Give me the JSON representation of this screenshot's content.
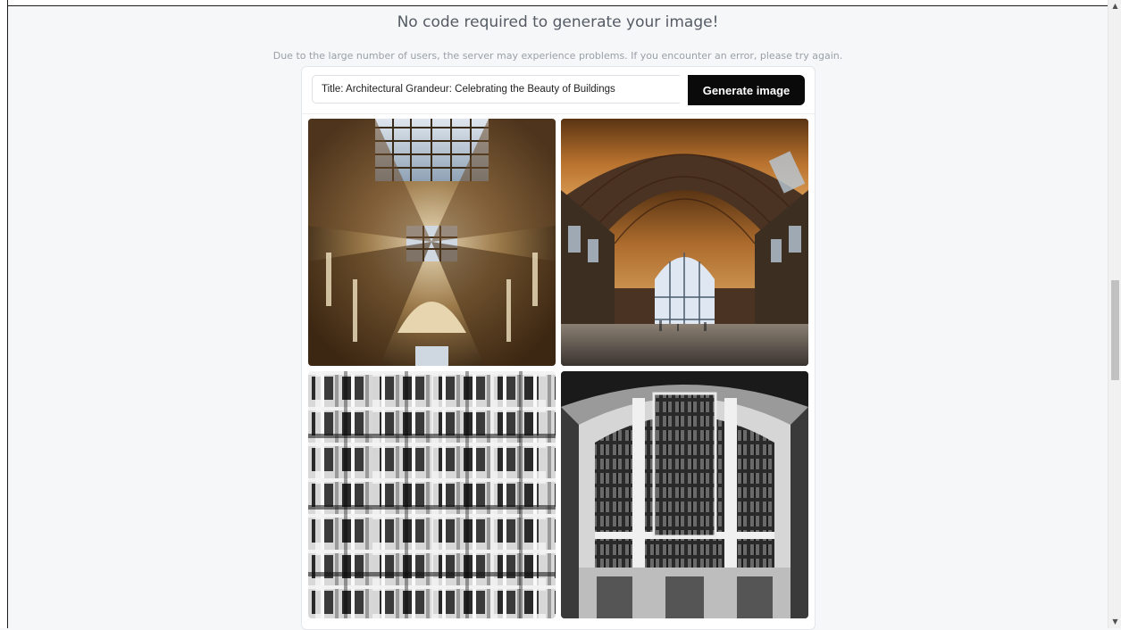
{
  "page": {
    "headline": "No code required to generate your image!",
    "notice": "Due to the large number of users, the server may experience problems. If you encounter an error, please try again."
  },
  "generator": {
    "prompt_value": "Title: Architectural Grandeur: Celebrating the Beauty of Buildings",
    "generate_label": "Generate image"
  },
  "results": {
    "images": [
      {
        "name": "result-image-ornate-ceiling",
        "icon": "image"
      },
      {
        "name": "result-image-vaulted-hall",
        "icon": "image"
      },
      {
        "name": "result-image-bw-facade",
        "icon": "image"
      },
      {
        "name": "result-image-bw-window",
        "icon": "image"
      }
    ]
  },
  "colors": {
    "background": "#f5f7f9",
    "button": "#0a0a0a",
    "button_text": "#ffffff",
    "headline_text": "#555b64",
    "notice_text": "#9aa0a8"
  },
  "scrollbar": {
    "up_icon": "triangle-up",
    "down_icon": "triangle-down"
  }
}
